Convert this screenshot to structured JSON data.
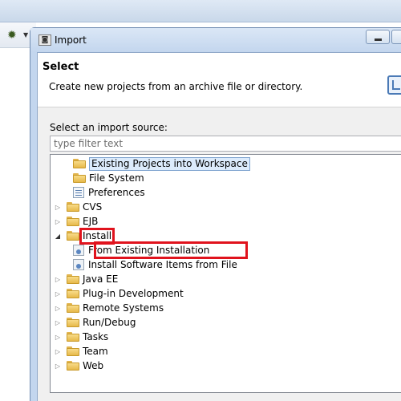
{
  "dialog": {
    "title": "Import",
    "header_title": "Select",
    "header_description": "Create new projects from an archive file or directory.",
    "source_label": "Select an import source:",
    "filter_placeholder": "type filter text"
  },
  "tree": {
    "items": [
      {
        "label": "Existing Projects into Workspace",
        "icon": "projects-folder-icon",
        "expanded": null,
        "selected": true
      },
      {
        "label": "File System",
        "icon": "folder-icon",
        "expanded": null
      },
      {
        "label": "Preferences",
        "icon": "preferences-icon",
        "expanded": null
      },
      {
        "label": "CVS",
        "icon": "folder-icon",
        "expanded": false
      },
      {
        "label": "EJB",
        "icon": "folder-icon",
        "expanded": false
      },
      {
        "label": "Install",
        "icon": "folder-icon",
        "expanded": true,
        "highlighted": true
      },
      {
        "label": "From Existing Installation",
        "icon": "install-icon",
        "expanded": null,
        "highlighted": true
      },
      {
        "label": "Install Software Items from File",
        "icon": "install-icon",
        "expanded": null
      },
      {
        "label": "Java EE",
        "icon": "folder-icon",
        "expanded": false
      },
      {
        "label": "Plug-in Development",
        "icon": "folder-icon",
        "expanded": false
      },
      {
        "label": "Remote Systems",
        "icon": "folder-icon",
        "expanded": false
      },
      {
        "label": "Run/Debug",
        "icon": "folder-icon",
        "expanded": false
      },
      {
        "label": "Tasks",
        "icon": "folder-icon",
        "expanded": false
      },
      {
        "label": "Team",
        "icon": "folder-icon",
        "expanded": false
      },
      {
        "label": "Web",
        "icon": "folder-icon",
        "expanded": false
      }
    ]
  },
  "colors": {
    "highlight_box": "#e0131d",
    "selection": "#dcebfc",
    "titlebar": "#c3d6ee"
  }
}
